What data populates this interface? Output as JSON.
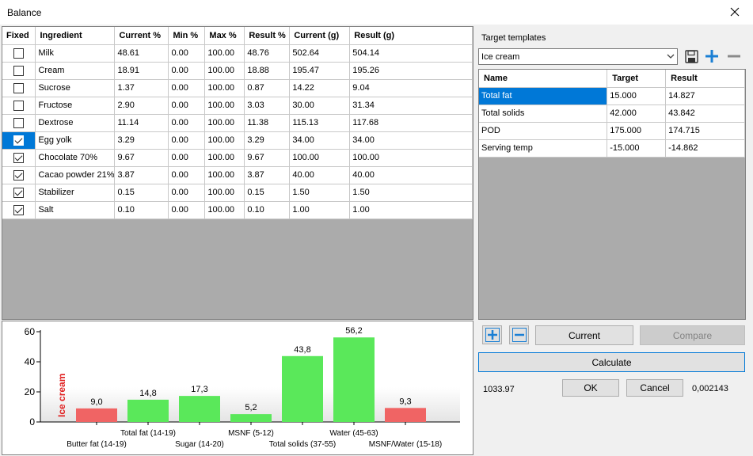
{
  "window": {
    "title": "Balance"
  },
  "grid": {
    "headers": [
      "Fixed",
      "Ingredient",
      "Current %",
      "Min %",
      "Max %",
      "Result %",
      "Current (g)",
      "Result (g)"
    ],
    "rows": [
      {
        "fixed": false,
        "ingredient": "Milk",
        "current_pct": "48.61",
        "min_pct": "0.00",
        "max_pct": "100.00",
        "result_pct": "48.76",
        "current_g": "502.64",
        "result_g": "504.14"
      },
      {
        "fixed": false,
        "ingredient": "Cream",
        "current_pct": "18.91",
        "min_pct": "0.00",
        "max_pct": "100.00",
        "result_pct": "18.88",
        "current_g": "195.47",
        "result_g": "195.26"
      },
      {
        "fixed": false,
        "ingredient": "Sucrose",
        "current_pct": "1.37",
        "min_pct": "0.00",
        "max_pct": "100.00",
        "result_pct": "0.87",
        "current_g": "14.22",
        "result_g": "9.04"
      },
      {
        "fixed": false,
        "ingredient": "Fructose",
        "current_pct": "2.90",
        "min_pct": "0.00",
        "max_pct": "100.00",
        "result_pct": "3.03",
        "current_g": "30.00",
        "result_g": "31.34"
      },
      {
        "fixed": false,
        "ingredient": "Dextrose",
        "current_pct": "11.14",
        "min_pct": "0.00",
        "max_pct": "100.00",
        "result_pct": "11.38",
        "current_g": "115.13",
        "result_g": "117.68"
      },
      {
        "fixed": true,
        "ingredient": "Egg yolk",
        "current_pct": "3.29",
        "min_pct": "0.00",
        "max_pct": "100.00",
        "result_pct": "3.29",
        "current_g": "34.00",
        "result_g": "34.00"
      },
      {
        "fixed": true,
        "ingredient": "Chocolate 70%",
        "current_pct": "9.67",
        "min_pct": "0.00",
        "max_pct": "100.00",
        "result_pct": "9.67",
        "current_g": "100.00",
        "result_g": "100.00"
      },
      {
        "fixed": true,
        "ingredient": "Cacao powder 21%",
        "current_pct": "3.87",
        "min_pct": "0.00",
        "max_pct": "100.00",
        "result_pct": "3.87",
        "current_g": "40.00",
        "result_g": "40.00"
      },
      {
        "fixed": true,
        "ingredient": "Stabilizer",
        "current_pct": "0.15",
        "min_pct": "0.00",
        "max_pct": "100.00",
        "result_pct": "0.15",
        "current_g": "1.50",
        "result_g": "1.50"
      },
      {
        "fixed": true,
        "ingredient": "Salt",
        "current_pct": "0.10",
        "min_pct": "0.00",
        "max_pct": "100.00",
        "result_pct": "0.10",
        "current_g": "1.00",
        "result_g": "1.00"
      }
    ],
    "selected_row": 5
  },
  "chart_data": {
    "type": "bar",
    "title": "Ice cream",
    "categories": [
      "Butter fat (14-19)",
      "Total fat (14-19)",
      "Sugar (14-20)",
      "MSNF (5-12)",
      "Total solids (37-55)",
      "Water (45-63)",
      "MSNF/Water (15-18)"
    ],
    "values": [
      9.0,
      14.8,
      17.3,
      5.2,
      43.8,
      56.2,
      9.3
    ],
    "value_labels": [
      "9,0",
      "14,8",
      "17,3",
      "5,2",
      "43,8",
      "56,2",
      "9,3"
    ],
    "in_range": [
      false,
      true,
      true,
      true,
      true,
      true,
      false
    ],
    "colors": {
      "ok": "#5ae85a",
      "out": "#f06464",
      "title": "#e02020"
    },
    "ylim": [
      0,
      60
    ],
    "yticks": [
      "0",
      "20",
      "40",
      "60"
    ],
    "grid": false
  },
  "templates": {
    "label": "Target templates",
    "selected": "Ice cream",
    "icons": {
      "save": "save-icon",
      "add": "plus-icon",
      "remove": "minus-icon"
    }
  },
  "targets": {
    "headers": [
      "Name",
      "Target",
      "Result"
    ],
    "rows": [
      {
        "name": "Total fat",
        "target": "15.000",
        "result": "14.827"
      },
      {
        "name": "Total solids",
        "target": "42.000",
        "result": "43.842"
      },
      {
        "name": "POD",
        "target": "175.000",
        "result": "174.715"
      },
      {
        "name": "Serving temp",
        "target": "-15.000",
        "result": "-14.862"
      }
    ],
    "selected_row": 0
  },
  "buttons": {
    "current": "Current",
    "compare": "Compare",
    "calculate": "Calculate",
    "ok": "OK",
    "cancel": "Cancel"
  },
  "status": {
    "total": "1033.97",
    "error": "0,002143"
  },
  "accent": "#0078d7"
}
